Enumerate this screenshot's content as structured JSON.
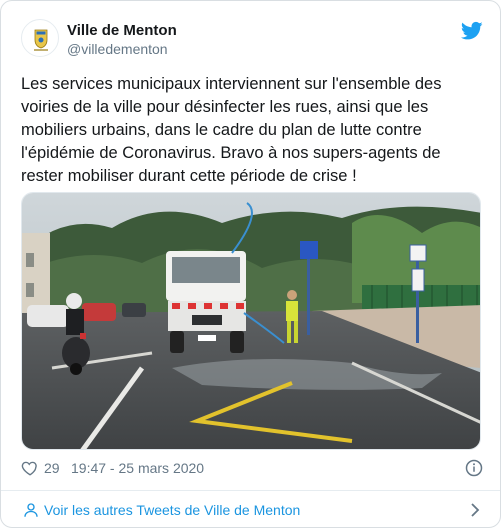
{
  "tweet": {
    "display_name": "Ville de Menton",
    "handle": "@villedementon",
    "text": "Les services municipaux interviennent sur l'ensemble des voiries de la ville pour désinfecter les rues, ainsi que les mobiliers urbains, dans le cadre du plan de lutte contre l'épidémie de Coronavirus. Bravo à nos supers-agents de rester mobiliser durant cette période de crise !",
    "likes": "29",
    "timestamp": "19:47 - 25 mars 2020"
  },
  "footer": {
    "more_tweets_label": "Voir les autres Tweets de Ville de Menton"
  },
  "icons": {
    "brand": "twitter-bird-icon",
    "like": "heart-icon",
    "info": "info-icon",
    "person": "person-icon",
    "chevron": "chevron-right-icon"
  },
  "colors": {
    "brand_blue": "#1da1f2",
    "link_blue": "#1b95e0",
    "text": "#14171a",
    "muted": "#657786"
  }
}
